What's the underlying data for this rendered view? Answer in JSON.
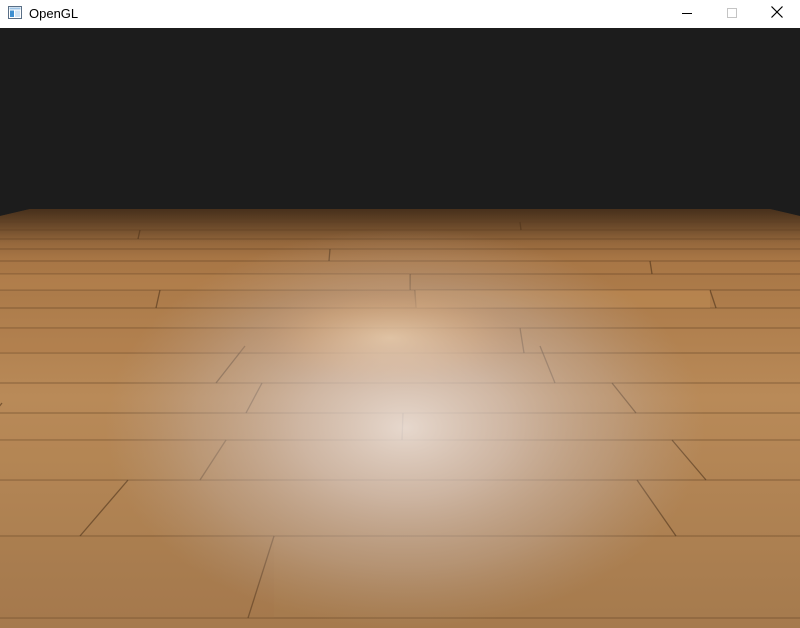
{
  "window": {
    "title": "OpenGL",
    "app_icon": "opengl-window-icon",
    "controls": {
      "minimize_icon": "minimize-icon",
      "maximize_icon": "maximize-icon",
      "close_icon": "close-icon"
    }
  },
  "scene": {
    "background_color": "#1c1c1c",
    "floor_texture": "wood-planks",
    "floor_base_color": "#9a6a3c",
    "light": "spotlight",
    "light_color": "#e8ddd4"
  }
}
